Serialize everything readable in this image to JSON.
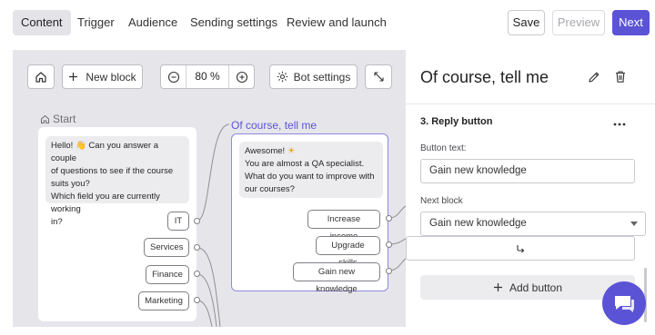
{
  "topnav": {
    "tabs": [
      {
        "label": "Content",
        "active": true
      },
      {
        "label": "Trigger"
      },
      {
        "label": "Audience"
      },
      {
        "label": "Sending settings"
      },
      {
        "label": "Review and launch"
      }
    ],
    "save_label": "Save",
    "preview_label": "Preview",
    "next_label": "Next",
    "accent_color": "#5b53d6"
  },
  "toolbar": {
    "home_icon": "home-icon",
    "new_block_label": "New block",
    "zoom_value": "80 %",
    "bot_settings_label": "Bot settings",
    "expand_icon": "expand-arrows-icon"
  },
  "canvas": {
    "start_label": "Start",
    "start_card": {
      "message": [
        "Hello! ",
        "Can you answer a couple",
        "of questions to see if the course",
        "suits you?",
        "Which field you are currently working",
        "in?"
      ],
      "emoji": "👋",
      "buttons": [
        "IT",
        "Services",
        "Finance",
        "Marketing"
      ]
    },
    "block_title": "Of course, tell me",
    "block_card": {
      "message_line1": "Awesome! ",
      "emoji": "☀",
      "message_lines": [
        "You are almost a QA specialist.",
        "What do you want to improve with",
        "our courses?"
      ],
      "buttons": [
        "Increase income",
        "Upgrade skills",
        "Gain new knowledge"
      ]
    }
  },
  "panel": {
    "title": "Of course, tell me",
    "section_title": "3. Reply button",
    "button_text_label": "Button text:",
    "button_text_value": "Gain new knowledge",
    "next_block_label": "Next block",
    "next_block_value": "Gain new knowledge",
    "add_button_label": "Add button"
  }
}
